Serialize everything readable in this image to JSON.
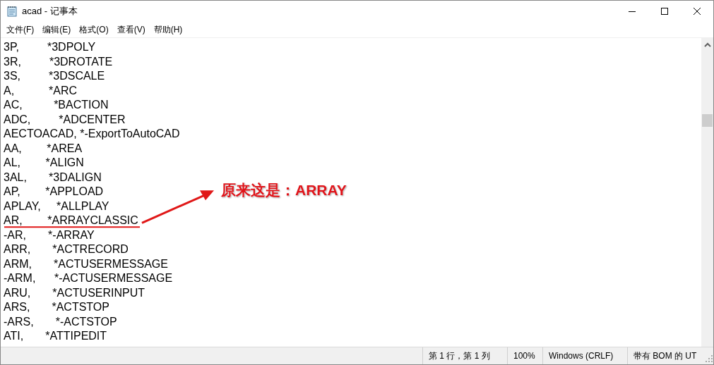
{
  "window": {
    "title": "acad - 记事本"
  },
  "menu": [
    "文件(F)",
    "编辑(E)",
    "格式(O)",
    "查看(V)",
    "帮助(H)"
  ],
  "lines": [
    "3P,         *3DPOLY",
    "3R,         *3DROTATE",
    "3S,         *3DSCALE",
    "A,           *ARC",
    "AC,          *BACTION",
    "ADC,         *ADCENTER",
    "AECTOACAD, *-ExportToAutoCAD",
    "AA,        *AREA",
    "AL,        *ALIGN",
    "3AL,       *3DALIGN",
    "AP,        *APPLOAD",
    "APLAY,     *ALLPLAY",
    "AR,        *ARRAYCLASSIC",
    "-AR,       *-ARRAY",
    "ARR,       *ACTRECORD",
    "ARM,       *ACTUSERMESSAGE",
    "-ARM,      *-ACTUSERMESSAGE",
    "ARU,       *ACTUSERINPUT",
    "ARS,       *ACTSTOP",
    "-ARS,       *-ACTSTOP",
    "ATI,       *ATTIPEDIT"
  ],
  "annotation": {
    "text": "原来这是：ARRAY"
  },
  "status_bar": [
    "第 1 行，第 1 列",
    "100%",
    "Windows (CRLF)",
    "带有 BOM 的 UT"
  ]
}
